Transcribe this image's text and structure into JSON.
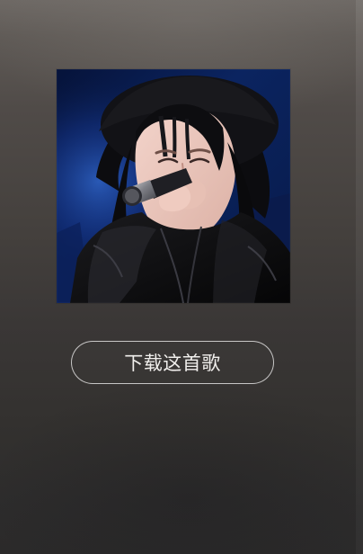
{
  "player": {
    "cover_icon": "singer-photo-icon",
    "download_button_label": "下载这首歌"
  },
  "colors": {
    "background_top": "#6d6864",
    "background_bottom": "#2b2a2a",
    "button_border": "#c9c4c0",
    "button_text": "#f1efed"
  }
}
